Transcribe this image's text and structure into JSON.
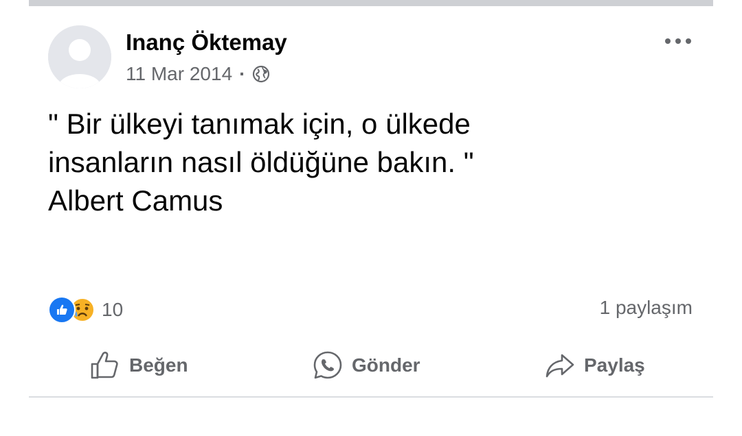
{
  "post": {
    "author": "Inanç Öktemay",
    "date": "11 Mar 2014",
    "separator": "·",
    "privacy_icon": "globe-icon",
    "text_lines": [
      "\" Bir ülkeyi tanımak için, o ülkede",
      "insanların nasıl öldüğüne bakın. \"",
      "",
      "Albert Camus"
    ],
    "more_icon": "more-dots-icon"
  },
  "stats": {
    "reactions": [
      "like",
      "sad"
    ],
    "reaction_count": "10",
    "shares": "1 paylaşım"
  },
  "actions": {
    "like": {
      "label": "Beğen",
      "icon": "thumbs-up-icon"
    },
    "send": {
      "label": "Gönder",
      "icon": "whatsapp-icon"
    },
    "share": {
      "label": "Paylaş",
      "icon": "share-arrow-icon"
    }
  },
  "colors": {
    "text": "#050505",
    "secondary": "#65676b",
    "like_blue": "#1877f2",
    "divider": "#ced0d4"
  }
}
